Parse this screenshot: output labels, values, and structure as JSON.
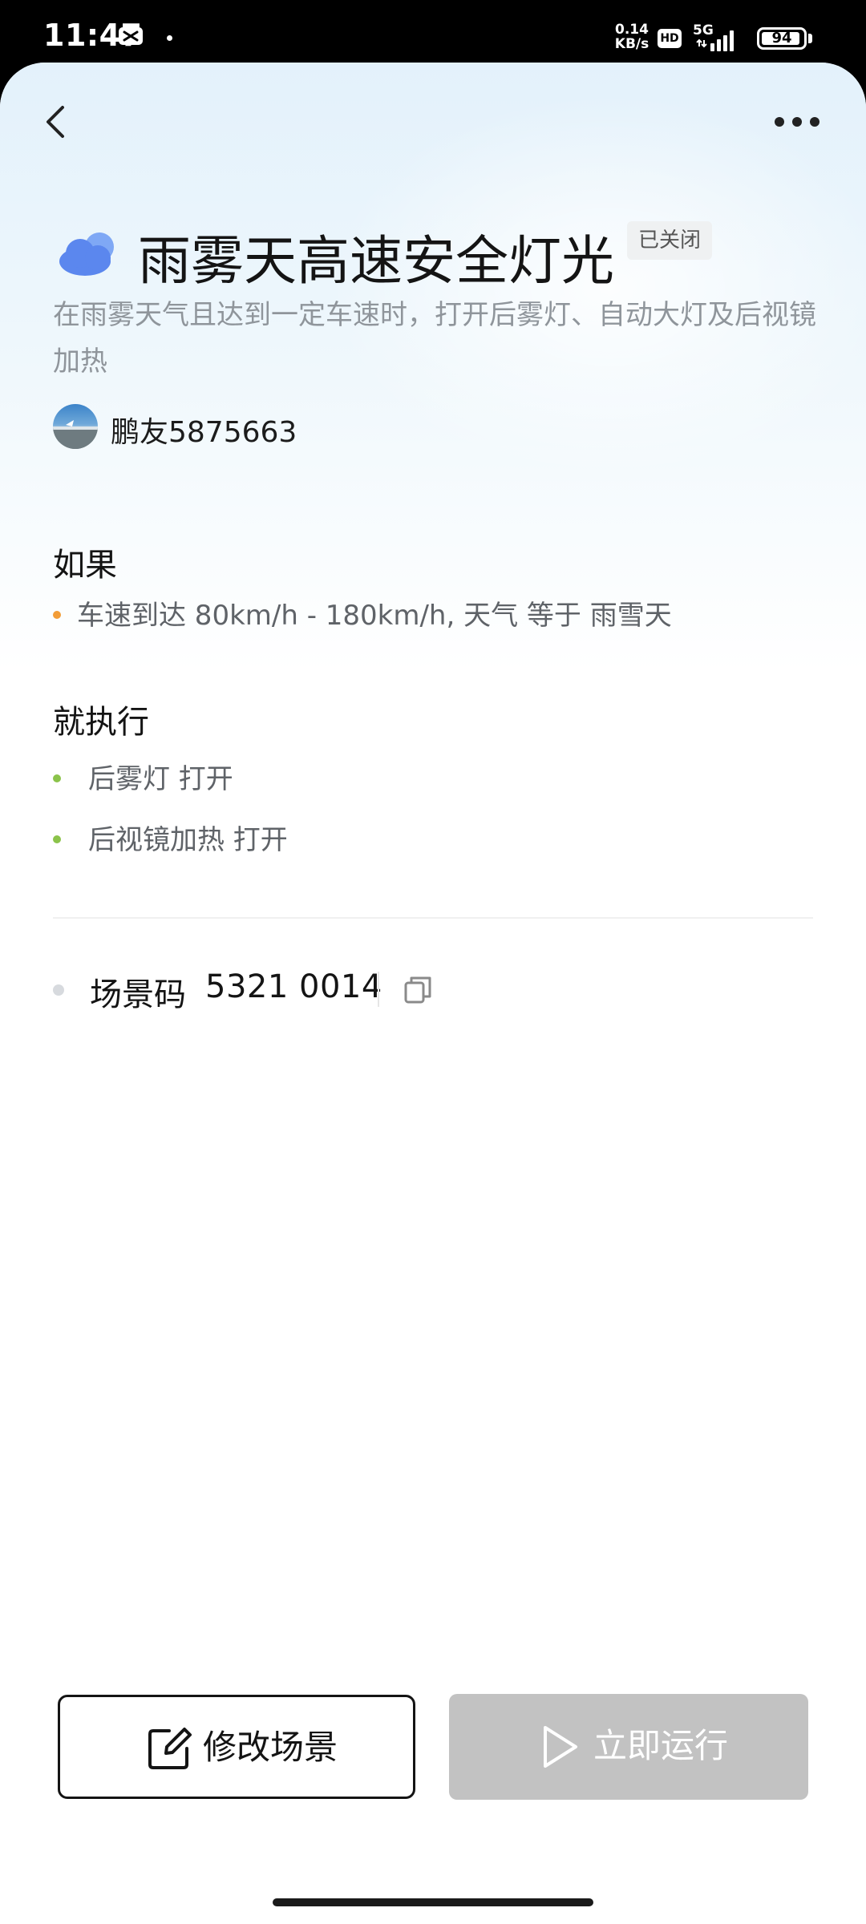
{
  "status_bar": {
    "time": "11:47",
    "net_speed_value": "0.14",
    "net_speed_unit": "KB/s",
    "hd_label": "HD",
    "network_label": "5G",
    "battery_level": "94"
  },
  "header": {
    "back_icon": "chevron-left-icon",
    "more_icon": "more-horizontal-icon"
  },
  "scene": {
    "icon": "cloud-icon",
    "title": "雨雾天高速安全灯光",
    "status": "已关闭",
    "description": "在雨雾天气且达到一定车速时，打开后雾灯、自动大灯及后视镜加热",
    "author": "鹏友5875663"
  },
  "conditions": {
    "title": "如果",
    "items": [
      {
        "text": "车速到达 80km/h - 180km/h, 天气 等于 雨雪天",
        "color": "#f29d38"
      }
    ]
  },
  "actions": {
    "title": "就执行",
    "items": [
      {
        "text": "后雾灯 打开",
        "color": "#8bc34a"
      },
      {
        "text": "后视镜加热 打开",
        "color": "#8bc34a"
      }
    ]
  },
  "scene_code": {
    "label": "场景码",
    "value": "5321 0014",
    "copy_icon": "copy-icon"
  },
  "footer": {
    "edit_label": "修改场景",
    "edit_icon": "edit-icon",
    "run_label": "立即运行",
    "run_icon": "play-icon",
    "run_bg": "#c2c2c2"
  }
}
